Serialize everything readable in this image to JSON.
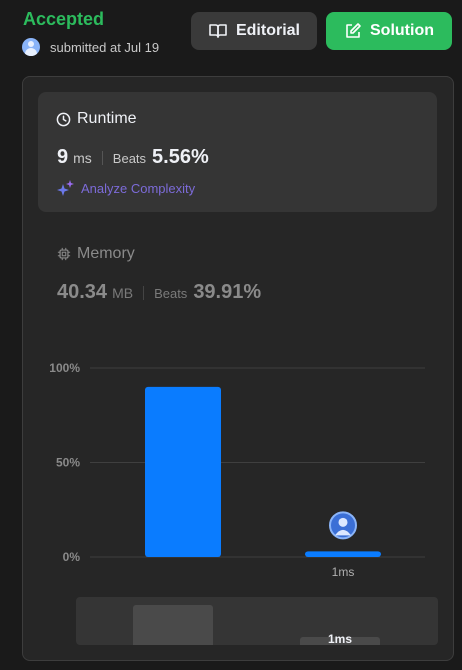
{
  "header": {
    "status": "Accepted",
    "submitted_text": "submitted at Jul 19",
    "editorial_label": "Editorial",
    "solution_label": "Solution"
  },
  "runtime": {
    "title": "Runtime",
    "value": "9",
    "unit": "ms",
    "beats_label": "Beats",
    "beats_value": "5.56%",
    "analyze_label": "Analyze Complexity"
  },
  "memory": {
    "title": "Memory",
    "value": "40.34",
    "unit": "MB",
    "beats_label": "Beats",
    "beats_value": "39.91%"
  },
  "colors": {
    "accepted": "#2cbb5d",
    "bar": "#0a7cff",
    "minimap_bar": "#4a4a4a"
  },
  "chart_data": {
    "type": "bar",
    "y_ticks": [
      "100%",
      "50%",
      "0%"
    ],
    "ylim": [
      0,
      100
    ],
    "bars": [
      {
        "label": "",
        "value": 90
      },
      {
        "label": "1ms",
        "value": 3,
        "is_user": true
      }
    ],
    "minimap": [
      {
        "label": "",
        "value": 90
      },
      {
        "label": "1ms",
        "value": 10
      }
    ]
  }
}
